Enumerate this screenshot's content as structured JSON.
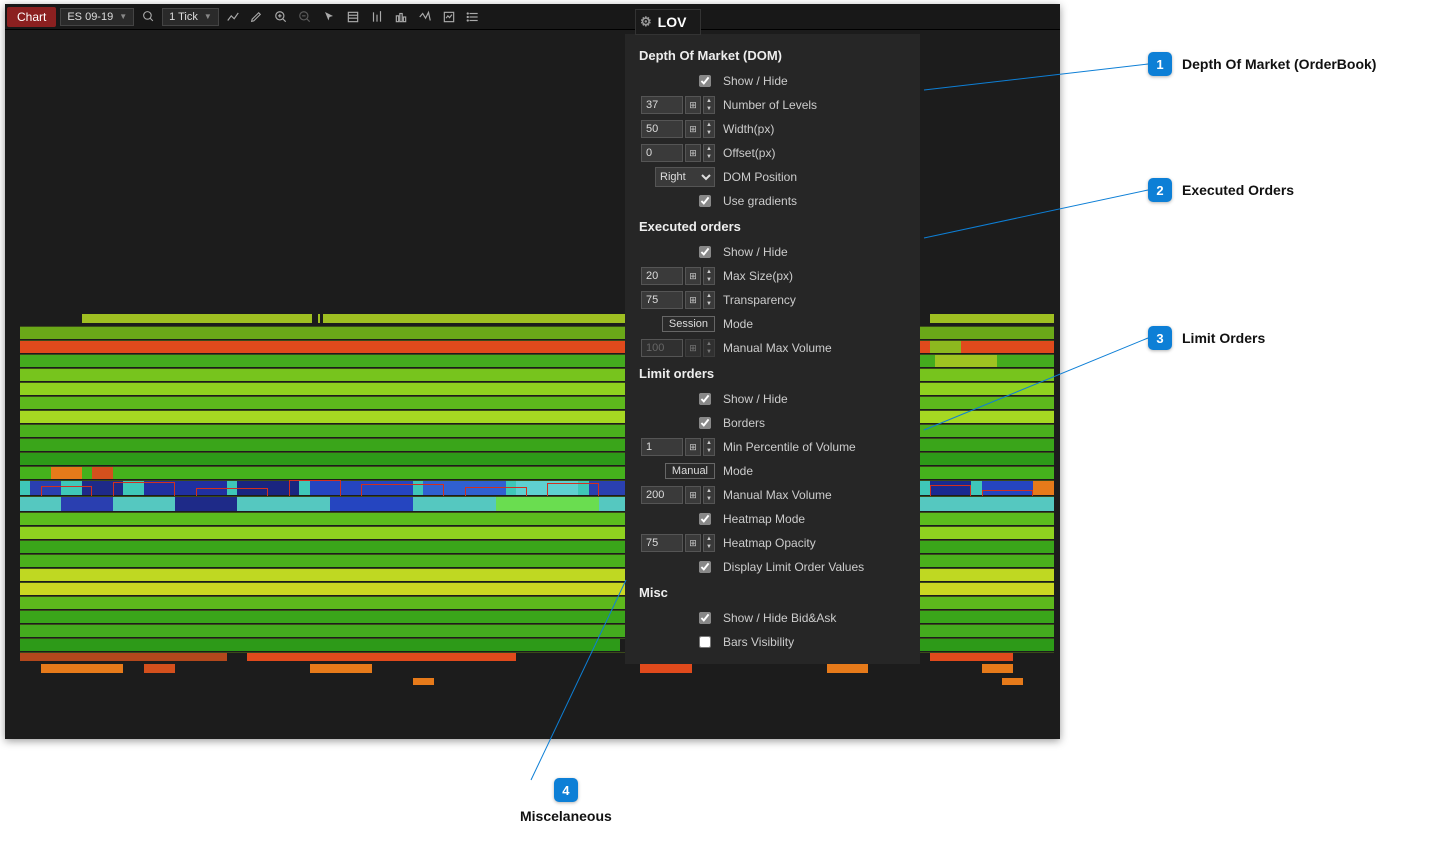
{
  "toolbar": {
    "chart_label": "Chart",
    "instrument": "ES 09-19",
    "interval": "1 Tick"
  },
  "lov_tab": "LOV",
  "panel": {
    "dom": {
      "title": "Depth Of Market (DOM)",
      "show_label": "Show / Hide",
      "show": true,
      "levels_label": "Number of Levels",
      "levels": "37",
      "width_label": "Width(px)",
      "width": "50",
      "offset_label": "Offset(px)",
      "offset": "0",
      "position_label": "DOM Position",
      "position": "Right",
      "gradients_label": "Use gradients",
      "gradients": true
    },
    "exec": {
      "title": "Executed orders",
      "show_label": "Show / Hide",
      "show": true,
      "maxsize_label": "Max Size(px)",
      "maxsize": "20",
      "transparency_label": "Transparency",
      "transparency": "75",
      "mode_label": "Mode",
      "mode": "Session",
      "manualmax_label": "Manual Max Volume",
      "manualmax": "100"
    },
    "limit": {
      "title": "Limit orders",
      "show_label": "Show / Hide",
      "show": true,
      "borders_label": "Borders",
      "borders": true,
      "minpct_label": "Min Percentile of Volume",
      "minpct": "1",
      "mode_label": "Mode",
      "mode": "Manual",
      "manualmax_label": "Manual Max Volume",
      "manualmax": "200",
      "heatmap_label": "Heatmap Mode",
      "heatmap": true,
      "opacity_label": "Heatmap Opacity",
      "opacity": "75",
      "display_values_label": "Display Limit Order Values",
      "display_values": true
    },
    "misc": {
      "title": "Misc",
      "bidask_label": "Show / Hide Bid&Ask",
      "bidask": true,
      "bars_label": "Bars Visibility",
      "bars": false
    }
  },
  "callouts": {
    "c1": {
      "num": "1",
      "text": "Depth Of Market (OrderBook)"
    },
    "c2": {
      "num": "2",
      "text": "Executed Orders"
    },
    "c3": {
      "num": "3",
      "text": "Limit Orders"
    },
    "c4": {
      "num": "4",
      "text": "Miscelaneous"
    }
  }
}
